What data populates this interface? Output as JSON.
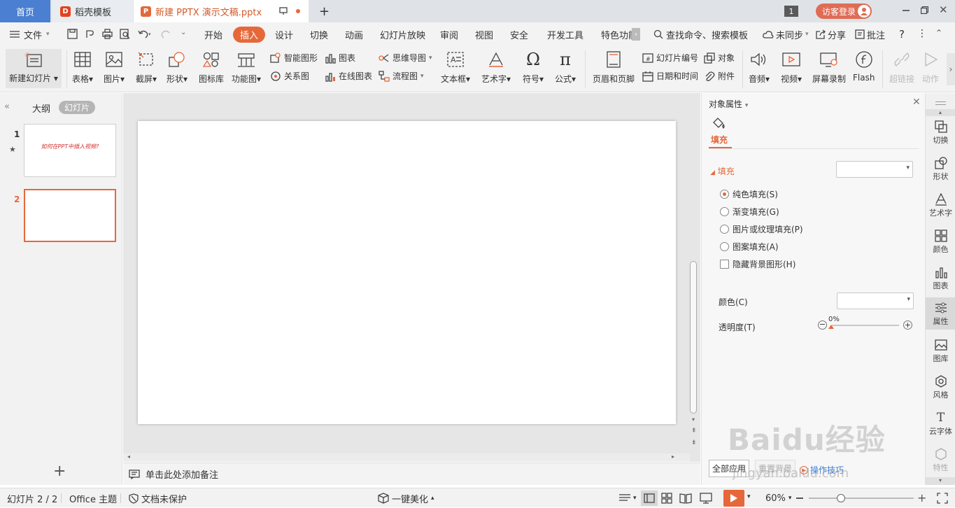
{
  "tabs": {
    "home": "首页",
    "docer": "稻壳模板",
    "document": "新建 PPTX 演示文稿.pptx",
    "window_count": "1",
    "login": "访客登录"
  },
  "menu": {
    "file": "文件",
    "items": [
      "开始",
      "插入",
      "设计",
      "切换",
      "动画",
      "幻灯片放映",
      "审阅",
      "视图",
      "安全",
      "开发工具",
      "特色功能"
    ],
    "active_index": 1,
    "search": "查找命令、搜索模板",
    "sync": "未同步",
    "share": "分享",
    "comment": "批注"
  },
  "ribbon": {
    "new_slide": "新建幻灯片",
    "table": "表格",
    "picture": "图片",
    "screenshot": "截屏",
    "shape": "形状",
    "icon_lib": "图标库",
    "func_chart": "功能图",
    "smart_shape": "智能图形",
    "chart": "图表",
    "relation": "关系图",
    "online_chart": "在线图表",
    "mind_map": "思维导图",
    "flowchart": "流程图",
    "textbox": "文本框",
    "wordart": "艺术字",
    "symbol": "符号",
    "formula": "公式",
    "header_footer": "页眉和页脚",
    "slide_number": "幻灯片编号",
    "object": "对象",
    "datetime": "日期和时间",
    "attachment": "附件",
    "audio": "音频",
    "video": "视频",
    "screen_record": "屏幕录制",
    "flash": "Flash",
    "hyperlink": "超链接",
    "action": "动作"
  },
  "left_panel": {
    "outline_tab": "大纲",
    "slides_tab": "幻灯片",
    "slides": [
      {
        "number": "1",
        "title": "如何在PPT中插入视频?"
      },
      {
        "number": "2",
        "title": ""
      }
    ]
  },
  "notes_placeholder": "单击此处添加备注",
  "properties": {
    "title": "对象属性",
    "tab_fill": "填充",
    "section_fill": "填充",
    "options": [
      "纯色填充(S)",
      "渐变填充(G)",
      "图片或纹理填充(P)",
      "图案填充(A)"
    ],
    "hide_bg": "隐藏背景图形(H)",
    "color_label": "颜色(C)",
    "transparency_label": "透明度(T)",
    "transparency_value": "0%",
    "apply_all": "全部应用",
    "reset_bg": "重置背景",
    "tips": "操作技巧"
  },
  "side_tools": [
    "切换",
    "形状",
    "艺术字",
    "颜色",
    "图表",
    "属性",
    "图库",
    "风格",
    "云字体",
    "特性"
  ],
  "status": {
    "slide_counter": "幻灯片 2 / 2",
    "theme": "Office 主题",
    "protect": "文档未保护",
    "beautify": "一键美化",
    "zoom": "60%"
  },
  "watermark": {
    "brand": "Baidu经验",
    "url": "jingyan.baidu.com"
  },
  "colors": {
    "accent": "#e6683a",
    "home_tab": "#4a7fd1"
  }
}
